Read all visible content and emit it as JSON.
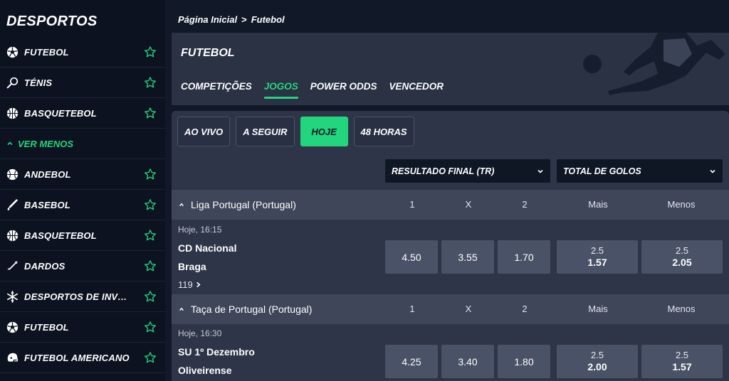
{
  "sidebar": {
    "title": "DESPORTOS",
    "top_items": [
      {
        "label": "FUTEBOL",
        "icon": "soccer-ball-icon"
      },
      {
        "label": "TÉNIS",
        "icon": "tennis-racket-icon"
      },
      {
        "label": "BASQUETEBOL",
        "icon": "basketball-icon"
      }
    ],
    "toggle_label": "VER MENOS",
    "more_items": [
      {
        "label": "ANDEBOL",
        "icon": "handball-icon"
      },
      {
        "label": "BASEBOL",
        "icon": "baseball-bat-icon"
      },
      {
        "label": "BASQUETEBOL",
        "icon": "basketball-icon"
      },
      {
        "label": "DARDOS",
        "icon": "darts-icon"
      },
      {
        "label": "DESPORTOS DE INVERNO",
        "icon": "snowflake-icon"
      },
      {
        "label": "FUTEBOL",
        "icon": "soccer-ball-icon"
      },
      {
        "label": "FUTEBOL AMERICANO",
        "icon": "football-helmet-icon"
      }
    ]
  },
  "breadcrumb": {
    "home": "Página Inicial",
    "separator": ">",
    "current": "Futebol"
  },
  "hero": {
    "title": "FUTEBOL",
    "tabs": [
      {
        "label": "COMPETIÇÕES",
        "active": false
      },
      {
        "label": "JOGOS",
        "active": true
      },
      {
        "label": "POWER ODDS",
        "active": false
      },
      {
        "label": "VENCEDOR",
        "active": false
      }
    ]
  },
  "filters": [
    {
      "label": "AO VIVO",
      "active": false
    },
    {
      "label": "A SEGUIR",
      "active": false
    },
    {
      "label": "HOJE",
      "active": true
    },
    {
      "label": "48 HORAS",
      "active": false
    }
  ],
  "market_selects": {
    "first": "RESULTADO FINAL (TR)",
    "second": "TOTAL DE GOLOS"
  },
  "columns": {
    "c1": "1",
    "cx": "X",
    "c2": "2",
    "over": "Mais",
    "under": "Menos"
  },
  "leagues": [
    {
      "name": "Liga Portugal (Portugal)",
      "match": {
        "time": "Hoje, 16:15",
        "home": "CD Nacional",
        "away": "Braga",
        "more_markets": "119",
        "odds": {
          "home": "4.50",
          "draw": "3.55",
          "away": "1.70"
        },
        "over": {
          "line": "2.5",
          "price": "1.57"
        },
        "under": {
          "line": "2.5",
          "price": "2.05"
        }
      }
    },
    {
      "name": "Taça de Portugal (Portugal)",
      "match": {
        "time": "Hoje, 16:30",
        "home": "SU 1º Dezembro",
        "away": "Oliveirense",
        "odds": {
          "home": "4.25",
          "draw": "3.40",
          "away": "1.80"
        },
        "over": {
          "line": "2.5",
          "price": "2.00"
        },
        "under": {
          "line": "2.5",
          "price": "1.57"
        }
      }
    }
  ],
  "colors": {
    "accent": "#22d67e",
    "background": "#0f1624",
    "panel": "#2e3548",
    "odds_button": "#4a5267"
  }
}
